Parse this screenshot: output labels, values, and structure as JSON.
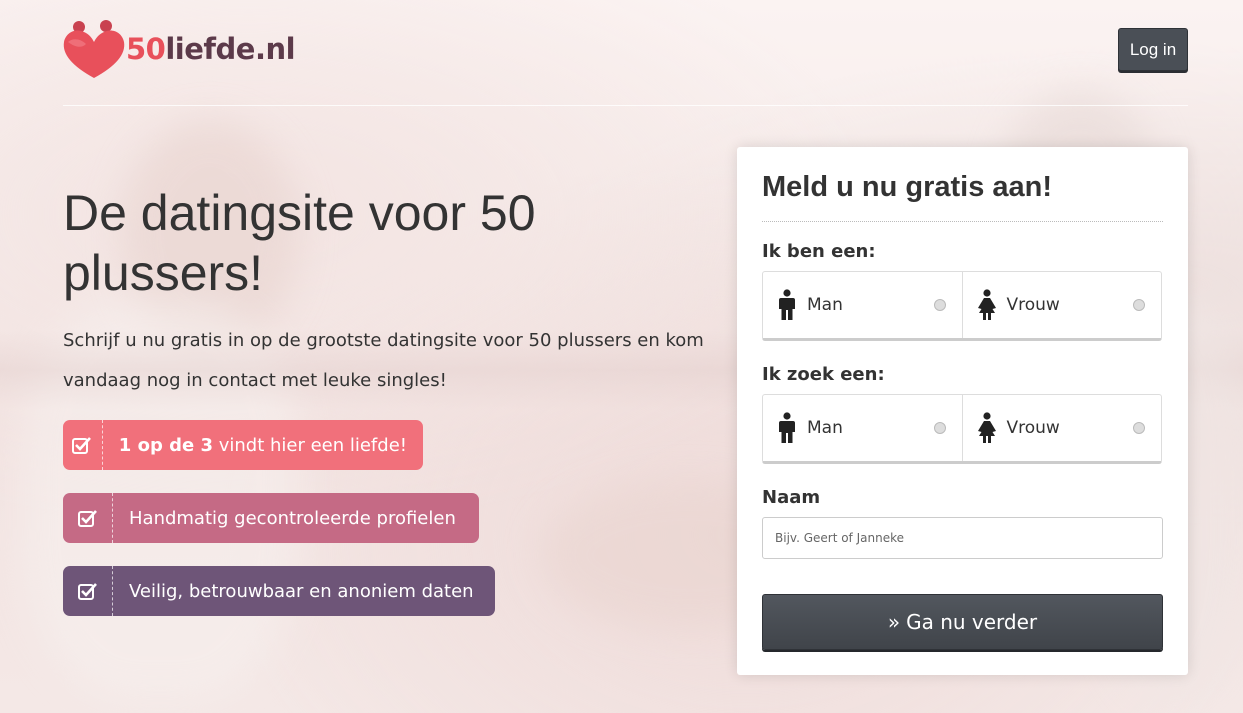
{
  "header": {
    "logo_number": "50",
    "logo_name": "liefde.nl",
    "login_label": "Log in"
  },
  "hero": {
    "title": "De datingsite voor 50 plussers!",
    "subtitle": "Schrijf u nu gratis in op de grootste datingsite voor 50 plussers en kom vandaag nog in contact met leuke singles!",
    "features": [
      {
        "bold": "1 op de 3",
        "text": " vindt hier een liefde!",
        "color": "#f1707b"
      },
      {
        "bold": "",
        "text": "Handmatig gecontroleerde profielen",
        "color": "#c56a85"
      },
      {
        "bold": "",
        "text": "Veilig, betrouwbaar en anoniem daten",
        "color": "#6e5578"
      }
    ]
  },
  "form": {
    "title": "Meld u nu gratis aan!",
    "gender_label": "Ik ben een:",
    "seeking_label": "Ik zoek een:",
    "option_man": "Man",
    "option_woman": "Vrouw",
    "name_label": "Naam",
    "name_placeholder": "Bijv. Geert of Janneke",
    "submit_label": "Ga nu verder"
  },
  "colors": {
    "brand_red": "#e8505b",
    "brand_plum": "#5c3a4a",
    "button_dark": "#4a4f56"
  }
}
